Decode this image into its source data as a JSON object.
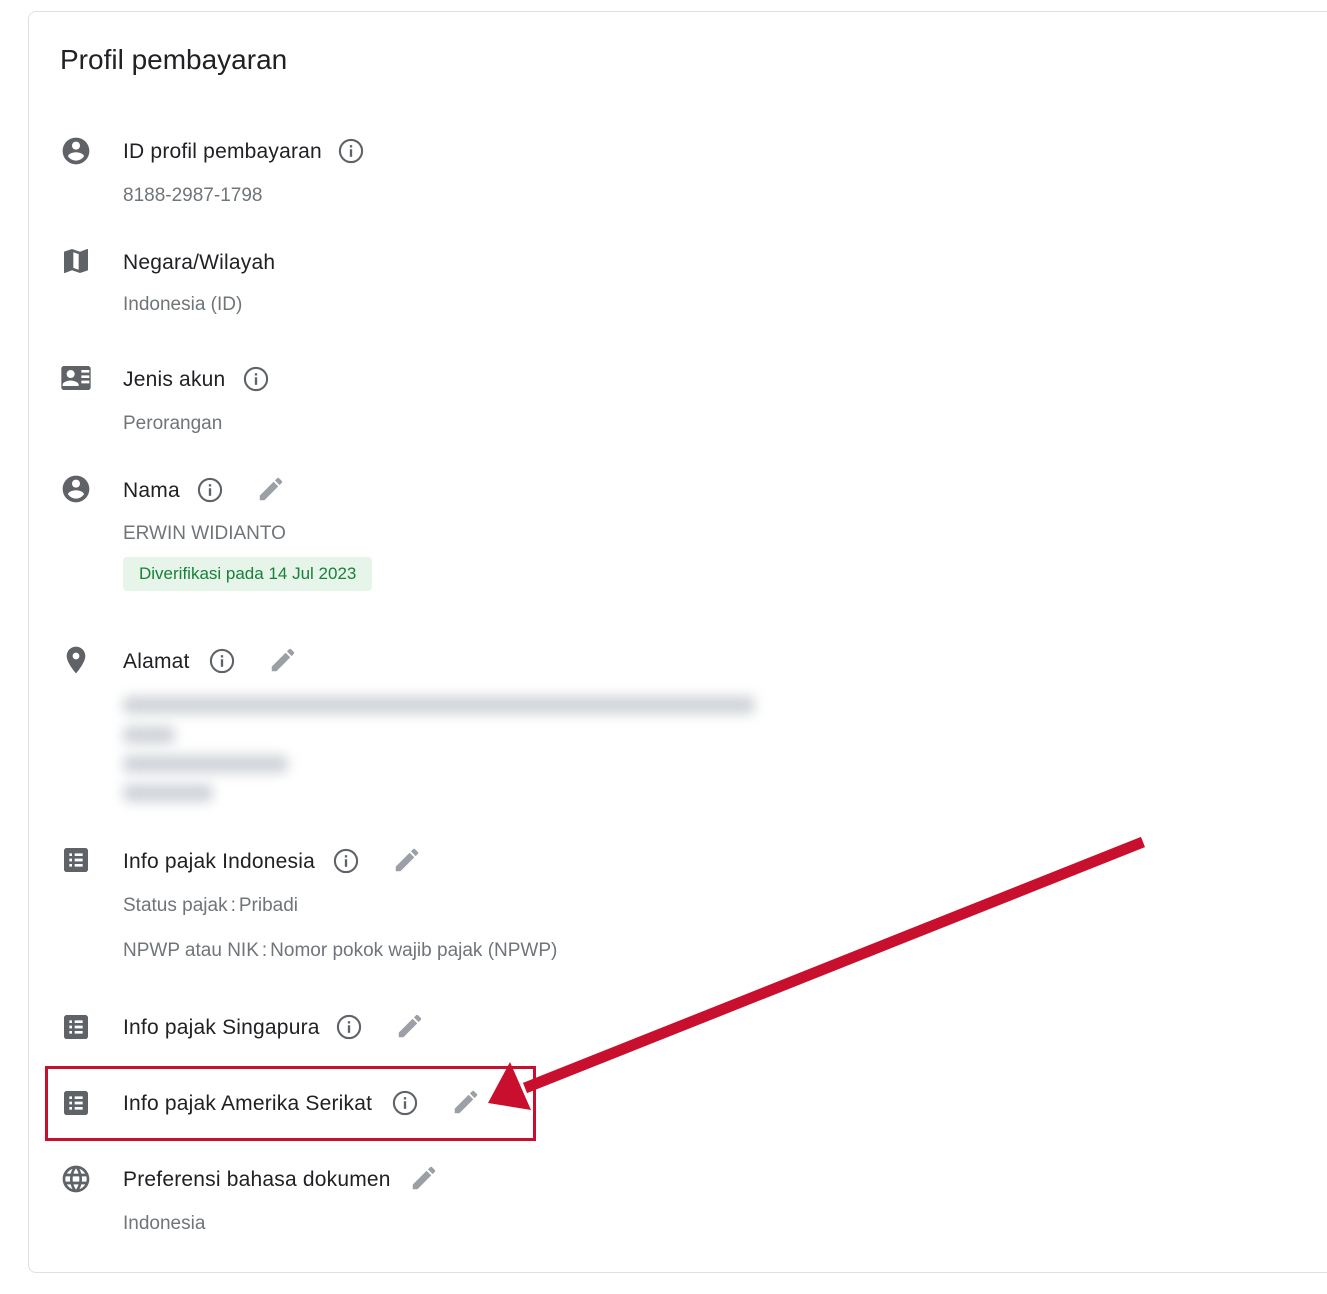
{
  "page": {
    "title": "Profil pembayaran"
  },
  "rows": {
    "profile_id": {
      "label": "ID profil pembayaran",
      "value": "8188-2987-1798",
      "icon": "account-circle-icon"
    },
    "country": {
      "label": "Negara/Wilayah",
      "value": "Indonesia (ID)",
      "icon": "map-icon"
    },
    "account_type": {
      "label": "Jenis akun",
      "value": "Perorangan",
      "icon": "contact-card-icon"
    },
    "name": {
      "label": "Nama",
      "value": "ERWIN WIDIANTO",
      "badge": "Diverifikasi pada 14 Jul 2023",
      "icon": "account-circle-icon"
    },
    "address": {
      "label": "Alamat",
      "icon": "location-pin-icon",
      "redacted": true
    },
    "tax_indonesia": {
      "label": "Info pajak Indonesia",
      "status_key": "Status pajak",
      "status_value": "Pribadi",
      "npwp_key": "NPWP atau NIK",
      "npwp_value": "Nomor pokok wajib pajak (NPWP)",
      "icon": "list-icon"
    },
    "tax_singapore": {
      "label": "Info pajak Singapura",
      "icon": "list-icon"
    },
    "tax_us": {
      "label": "Info pajak Amerika Serikat",
      "icon": "list-icon"
    },
    "doc_language": {
      "label": "Preferensi bahasa dokumen",
      "value": "Indonesia",
      "icon": "globe-icon"
    }
  },
  "colors": {
    "annotation_red": "#c8102e",
    "verified_bg": "#e6f4ea",
    "verified_text": "#188038",
    "icon_gray": "#5f6368"
  }
}
